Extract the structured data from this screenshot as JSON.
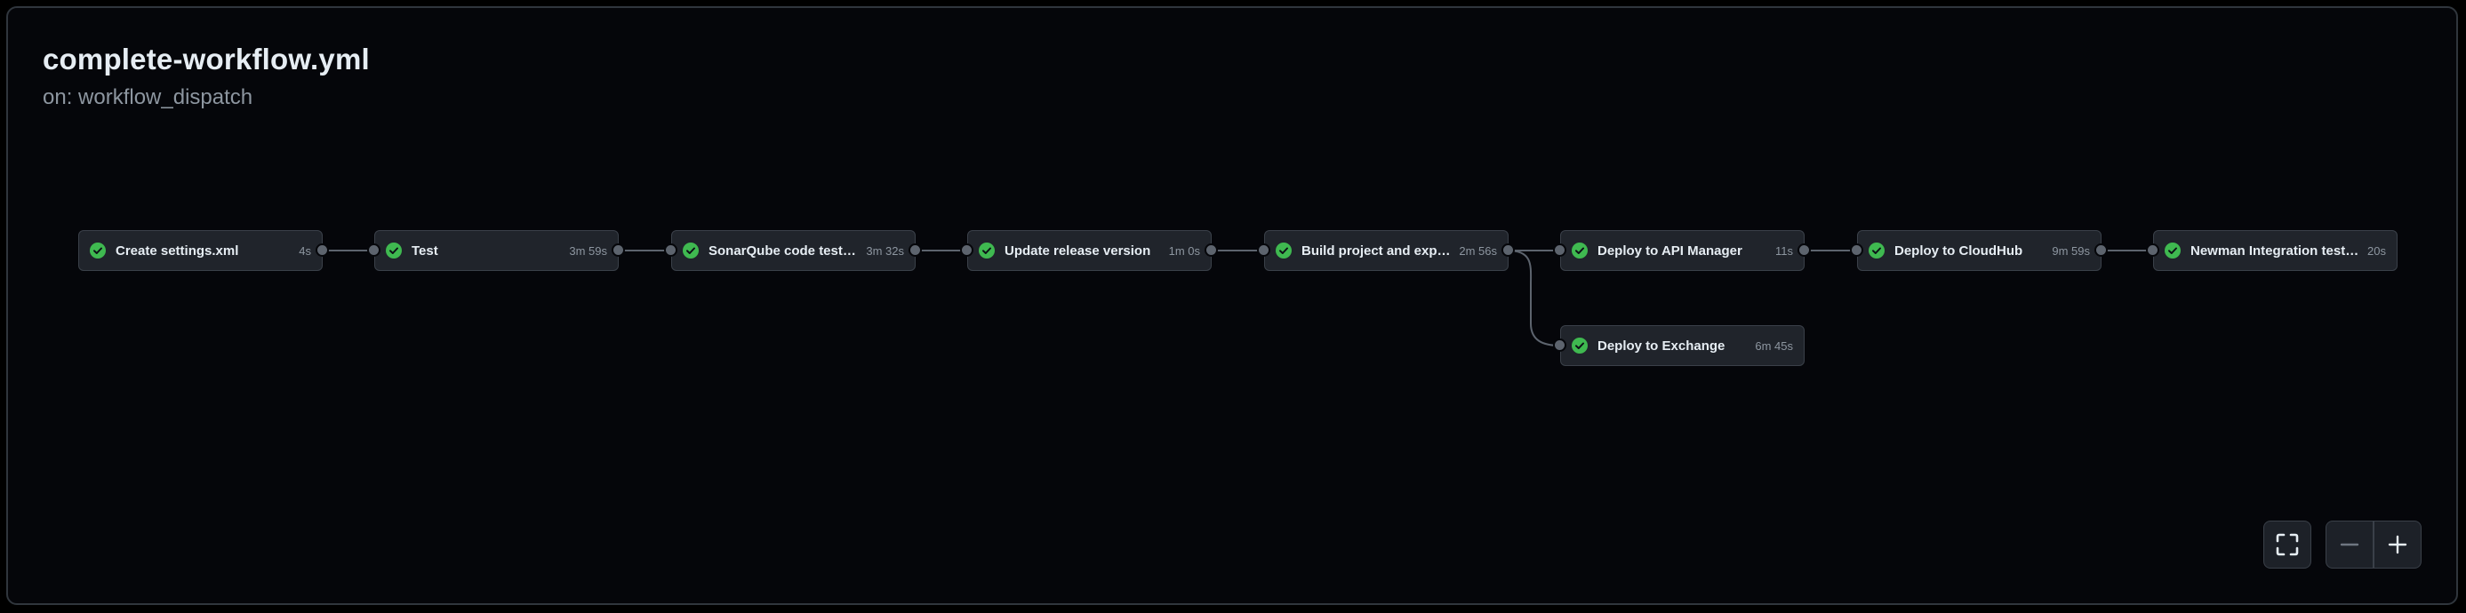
{
  "workflow": {
    "title": "complete-workflow.yml",
    "trigger": "on: workflow_dispatch"
  },
  "jobs": [
    {
      "name": "Create settings.xml",
      "duration": "4s",
      "status": "success"
    },
    {
      "name": "Test",
      "duration": "3m 59s",
      "status": "success"
    },
    {
      "name": "SonarQube code testing",
      "duration": "3m 32s",
      "status": "success"
    },
    {
      "name": "Update release version",
      "duration": "1m 0s",
      "status": "success"
    },
    {
      "name": "Build project and expo…",
      "duration": "2m 56s",
      "status": "success"
    },
    {
      "name": "Deploy to API Manager",
      "duration": "11s",
      "status": "success"
    },
    {
      "name": "Deploy to CloudHub",
      "duration": "9m 59s",
      "status": "success"
    },
    {
      "name": "Newman Integration testing",
      "duration": "20s",
      "status": "success"
    },
    {
      "name": "Deploy to Exchange",
      "duration": "6m 45s",
      "status": "success"
    }
  ],
  "colors": {
    "background": "#05060a",
    "card": "#20242b",
    "border": "#3a4049",
    "success": "#3fb950",
    "text": "#e6edf3",
    "muted": "#8d96a0",
    "edge": "#5d646e"
  },
  "icons": {
    "status": "check-circle-icon",
    "fullscreen": "fullscreen-icon",
    "zoom_out": "minus-icon",
    "zoom_in": "plus-icon"
  }
}
